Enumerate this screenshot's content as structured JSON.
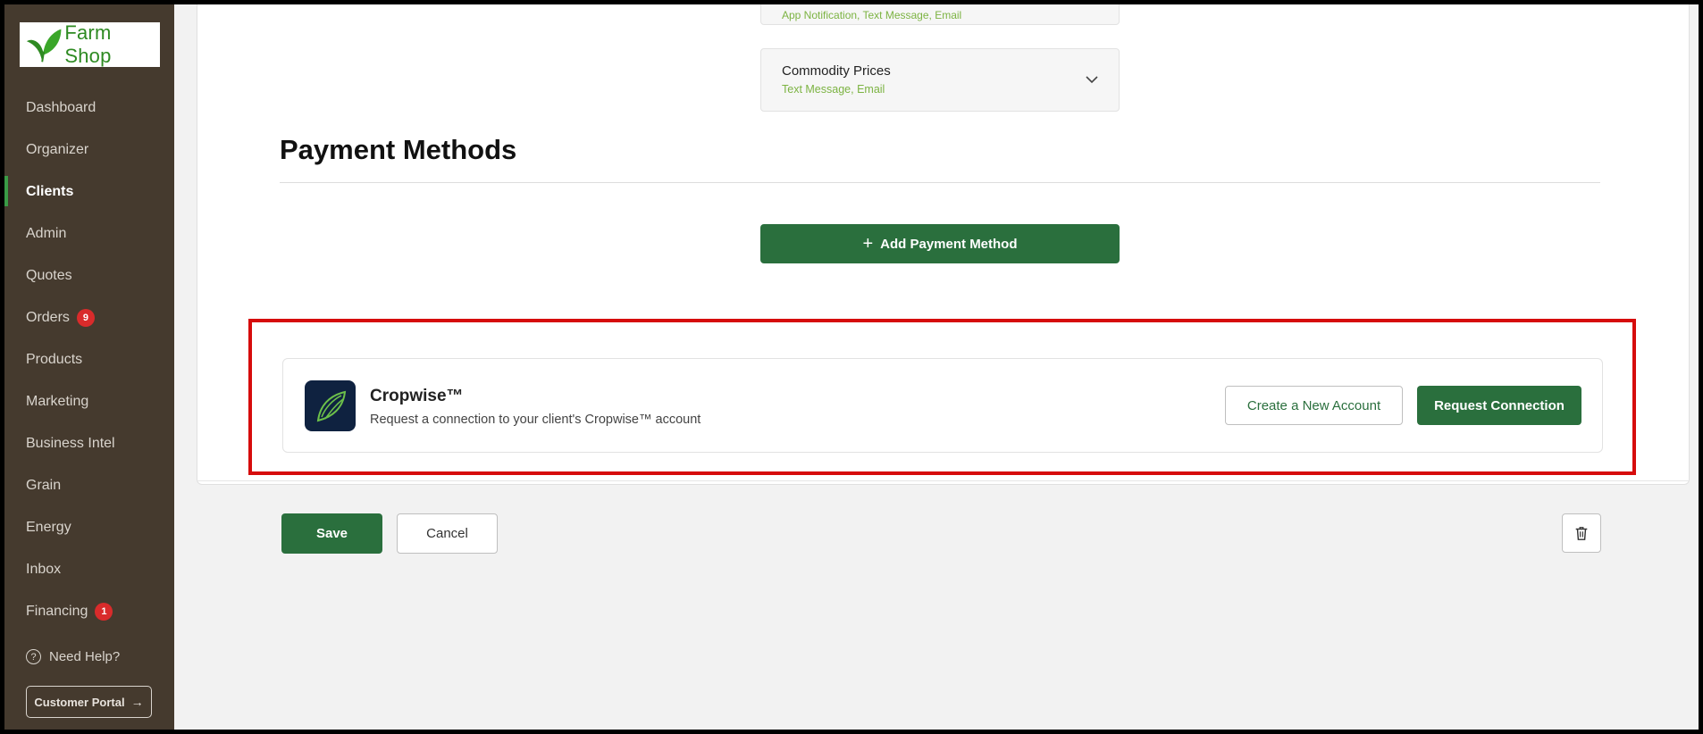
{
  "brand": {
    "name": "Farm Shop",
    "color": "#2e8a22"
  },
  "sidebar": {
    "items": [
      {
        "label": "Dashboard"
      },
      {
        "label": "Organizer"
      },
      {
        "label": "Clients",
        "active": true
      },
      {
        "label": "Admin"
      },
      {
        "label": "Quotes"
      },
      {
        "label": "Orders",
        "badge": "9"
      },
      {
        "label": "Products"
      },
      {
        "label": "Marketing"
      },
      {
        "label": "Business Intel"
      },
      {
        "label": "Grain"
      },
      {
        "label": "Energy"
      },
      {
        "label": "Inbox"
      },
      {
        "label": "Financing",
        "badge": "1"
      }
    ],
    "help_label": "Need Help?",
    "portal_label": "Customer Portal"
  },
  "notifications": {
    "previous_channels": "App Notification, Text Message, Email",
    "commodity": {
      "title": "Commodity Prices",
      "channels": "Text Message, Email"
    }
  },
  "payment": {
    "title": "Payment Methods",
    "add_label": "Add Payment Method"
  },
  "integration": {
    "name": "Cropwise™",
    "description": "Request a connection to your client's Cropwise™ account",
    "create_label": "Create a New Account",
    "request_label": "Request Connection"
  },
  "actions": {
    "save_label": "Save",
    "cancel_label": "Cancel"
  },
  "colors": {
    "primary": "#2a6f3d",
    "sidebar_bg": "#453a2e",
    "accent_text": "#7cb342",
    "highlight": "#d60c0c"
  }
}
